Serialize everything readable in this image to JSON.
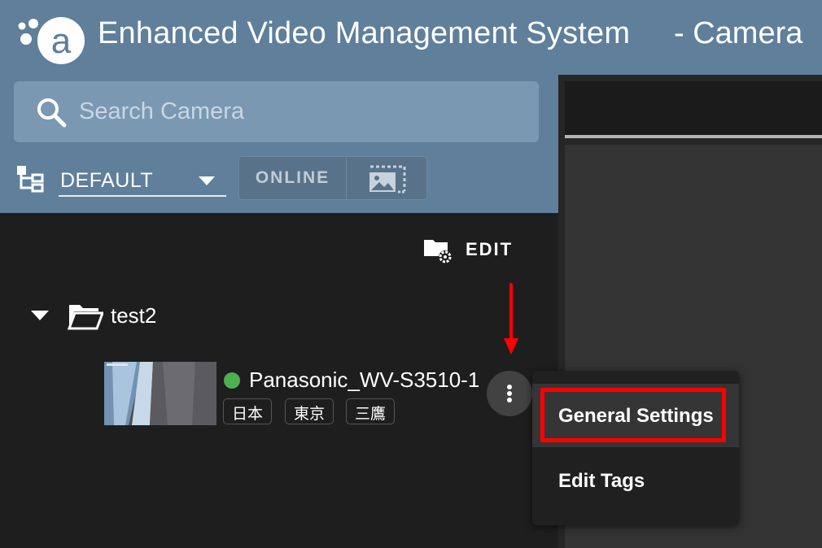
{
  "header": {
    "app_title": "Enhanced Video Management System",
    "page_title": "- Camera",
    "logo_icon": "axxon-logo-icon"
  },
  "search": {
    "placeholder": "Search Camera",
    "value": ""
  },
  "filters": {
    "group": "DEFAULT",
    "online_label": "ONLINE"
  },
  "toolbar": {
    "edit_label": "EDIT"
  },
  "tree": {
    "folder_name": "test2",
    "cameras": [
      {
        "name": "Panasonic_WV-S3510-1",
        "status": "online",
        "status_color": "#4caf50",
        "tags": [
          "日本",
          "東京",
          "三鷹"
        ]
      }
    ]
  },
  "context_menu": {
    "items": [
      {
        "label": "General Settings",
        "highlighted": true
      },
      {
        "label": "Edit Tags",
        "highlighted": false
      }
    ]
  },
  "colors": {
    "header_bg": "#5f7f9b",
    "panel_bg": "#1e1e1e",
    "annotation_red": "#ff0000"
  }
}
